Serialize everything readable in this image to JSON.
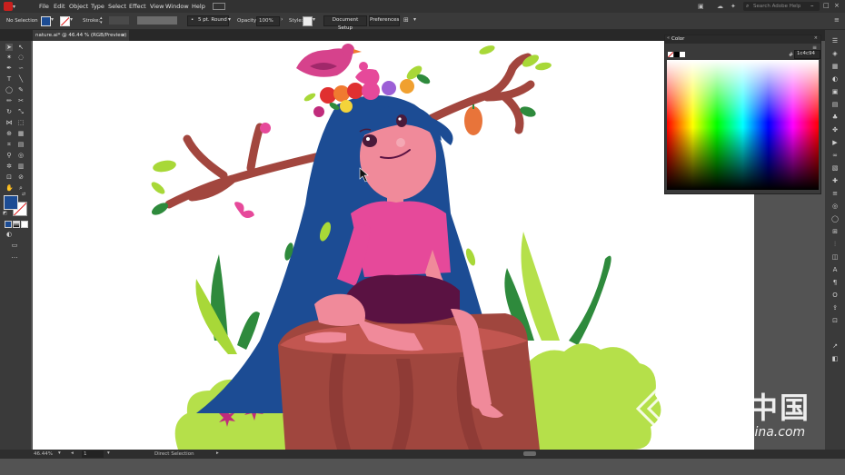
{
  "menubar": {
    "app_icon": "adobe-illustrator-logo",
    "items": [
      "File",
      "Edit",
      "Object",
      "Type",
      "Select",
      "Effect",
      "View",
      "Window",
      "Help"
    ],
    "search_placeholder": "Search Adobe Help"
  },
  "control_bar": {
    "selection_label": "No Selection",
    "stroke_label": "Stroke:",
    "brush_label": "5 pt. Round",
    "opacity_label": "Opacity:",
    "opacity_value": "100%",
    "style_label": "Style:",
    "document_setup_label": "Document Setup",
    "preferences_label": "Preferences"
  },
  "document_tab": {
    "title": "nature.ai* @ 46.44 % (RGB/Preview)",
    "close_glyph": "×"
  },
  "color_panel": {
    "title": "Color",
    "hex_value": "1c4c94"
  },
  "status_bar": {
    "zoom": "46.44%",
    "artboard": "1",
    "tool_name": "Direct Selection"
  },
  "watermark": {
    "cn_text": "灵感中国",
    "url_text": "lingganchina.com"
  },
  "colors": {
    "fill_swatch": "#1c4c94",
    "hair": "#1c4c94",
    "skin": "#f08a9a",
    "shirt": "#e6499a",
    "skirt": "#5a1242",
    "stump": "#a0463e",
    "branch": "#a2463e",
    "leaf": "#a8d838",
    "dark_leaf": "#2e8a3c",
    "bush": "#b5e04a",
    "bird": "#d6428c",
    "fruit": "#e8743a"
  }
}
